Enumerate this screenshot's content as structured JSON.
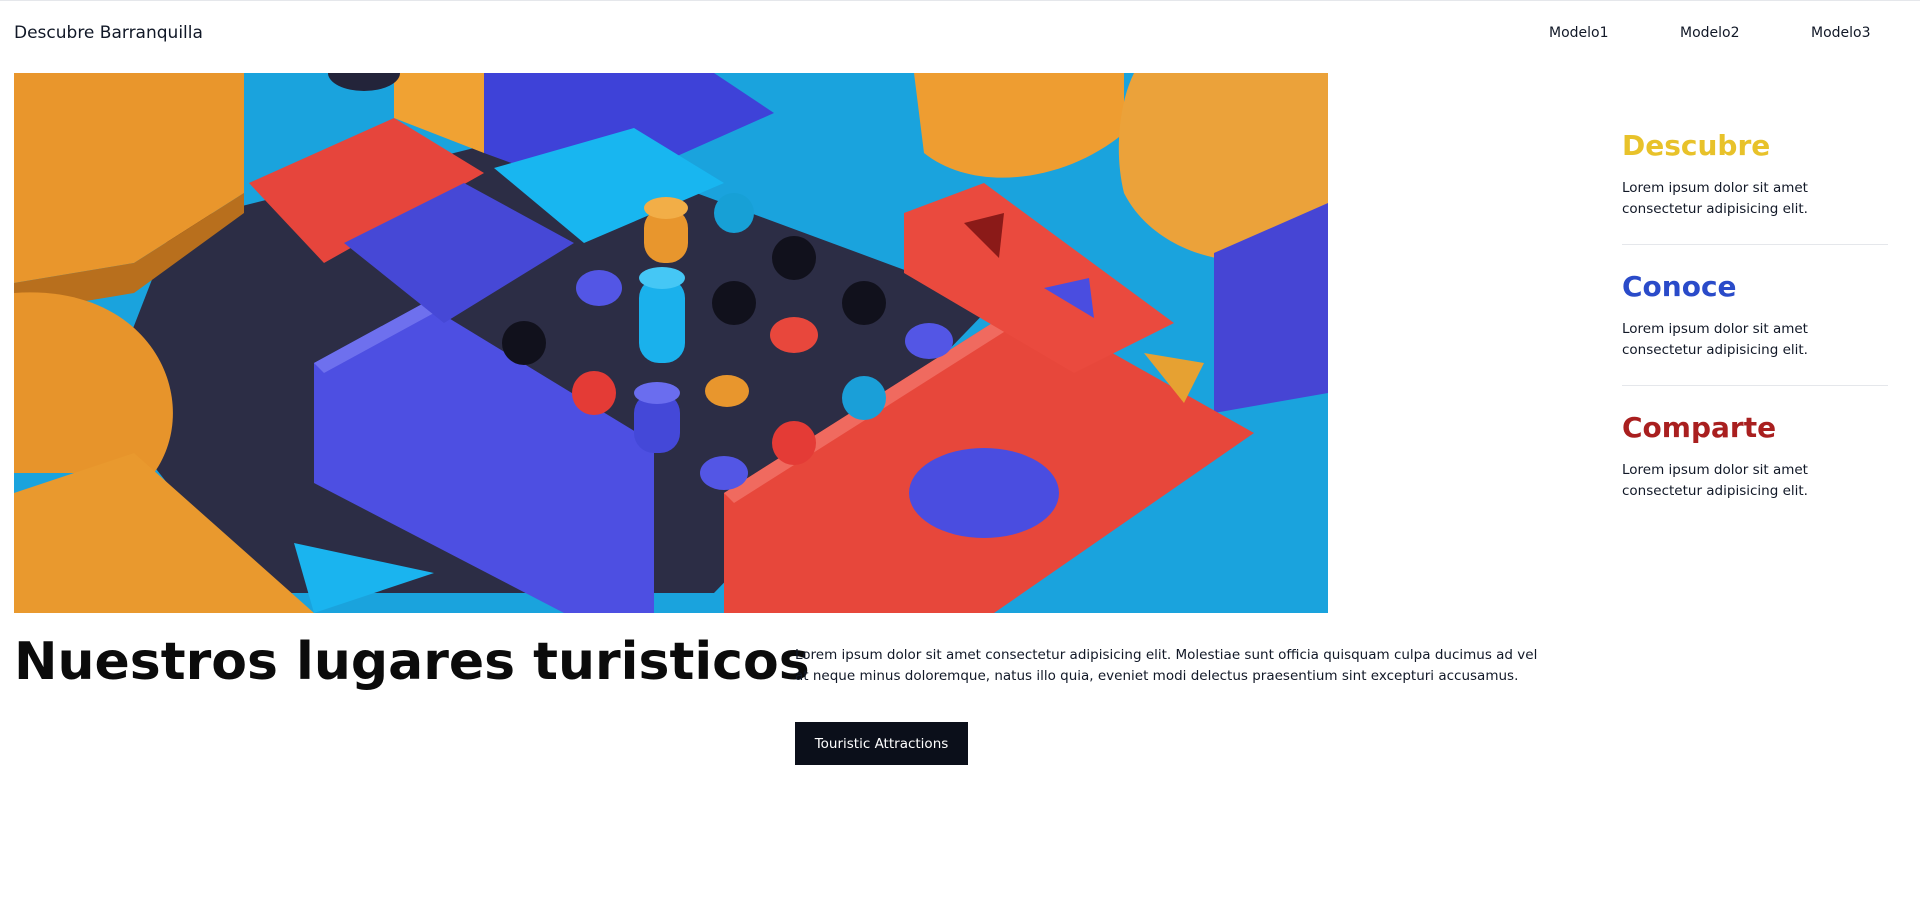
{
  "header": {
    "brand": "Descubre Barranquilla",
    "nav": [
      {
        "label": "Modelo1"
      },
      {
        "label": "Modelo2"
      },
      {
        "label": "Modelo3"
      }
    ]
  },
  "hero": {
    "image_subject": "3D colorful geometric blocks puzzle illustration"
  },
  "sidebar": {
    "items": [
      {
        "title": "Descubre",
        "text": "Lorem ipsum dolor sit amet consectetur adipisicing elit.",
        "color": "#e8c22a"
      },
      {
        "title": "Conoce",
        "text": "Lorem ipsum dolor sit amet consectetur adipisicing elit.",
        "color": "#2a4bc9"
      },
      {
        "title": "Comparte",
        "text": "Lorem ipsum dolor sit amet consectetur adipisicing elit.",
        "color": "#a91f1f"
      }
    ]
  },
  "main": {
    "headline": "Nuestros lugares turisticos",
    "intro": "Lorem ipsum dolor sit amet consectetur adipisicing elit. Molestiae sunt officia quisquam culpa ducimus ad vel at neque minus doloremque, natus illo quia, eveniet modi delectus praesentium sint excepturi accusamus.",
    "cta_label": "Touristic Attractions"
  }
}
